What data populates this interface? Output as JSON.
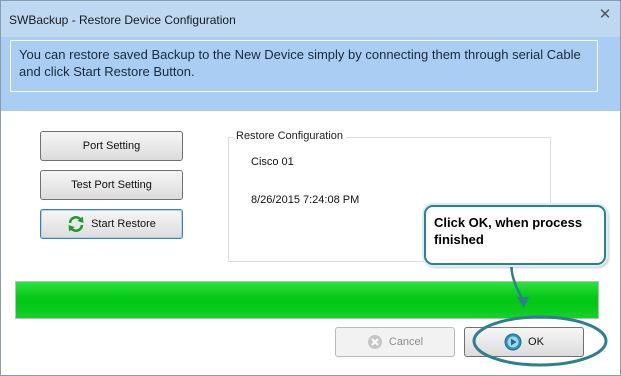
{
  "window": {
    "title": "SWBackup - Restore Device Configuration",
    "close_glyph": "✕"
  },
  "header": {
    "message": "You can restore saved Backup to the New Device simply by connecting them through serial Cable and click Start Restore Button."
  },
  "buttons": {
    "port_setting": "Port Setting",
    "test_port_setting": "Test Port Setting",
    "start_restore": "Start Restore",
    "cancel": "Cancel",
    "ok": "OK"
  },
  "restore_configuration": {
    "title": "Restore Configuration",
    "device": "Cisco 01",
    "timestamp": "8/26/2015 7:24:08 PM"
  },
  "progress": {
    "percent": 100,
    "color": "#00c814"
  },
  "callout": {
    "text": "Click OK, when process finished"
  },
  "icons": {
    "start_restore": "refresh-arrows-icon",
    "cancel": "cancel-x-circle-icon",
    "ok": "play-circle-icon"
  },
  "colors": {
    "header_bg": "#a9cdf3",
    "titlebar_bg": "#bfd8f2",
    "annotation": "#2e7f8f"
  }
}
